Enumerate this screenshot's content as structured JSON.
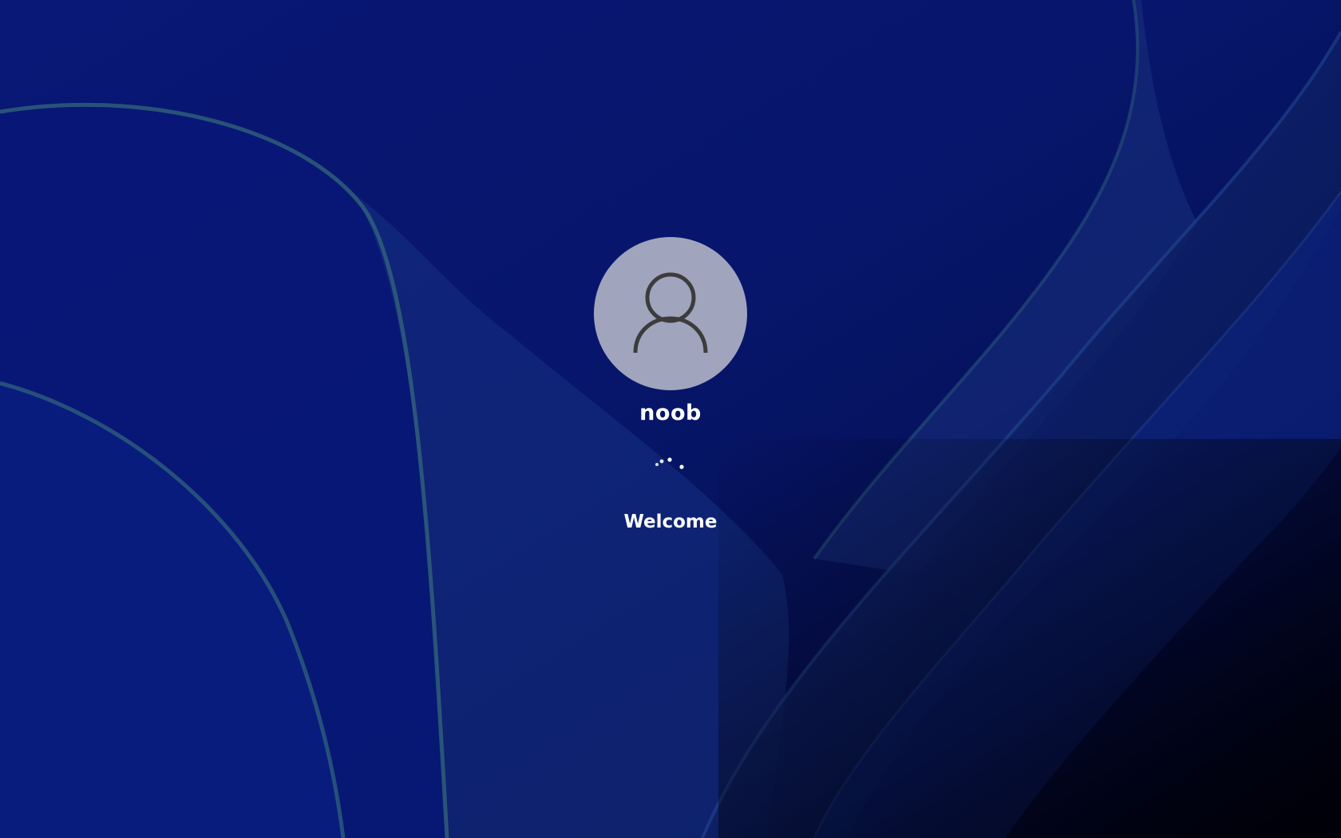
{
  "login": {
    "user_name": "noob",
    "status_text": "Welcome",
    "avatar_icon": "user-silhouette-icon",
    "spinner_icon": "loading-dots-icon"
  },
  "colors": {
    "avatar_background": "#a0a5bd",
    "avatar_glyph": "#3c3c3c",
    "text": "#ffffff",
    "wallpaper_base": "#0a1a7a"
  }
}
